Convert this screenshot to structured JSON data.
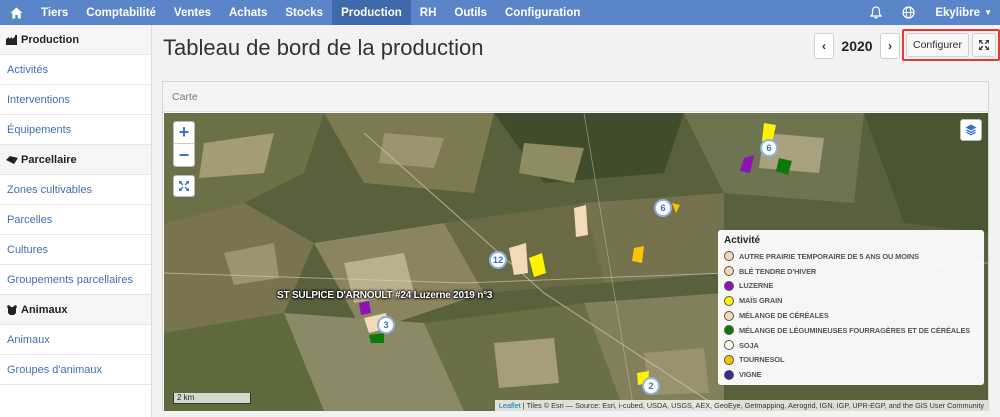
{
  "topnav": {
    "home_icon": "home-icon",
    "items": [
      {
        "label": "Tiers",
        "active": false
      },
      {
        "label": "Comptabilité",
        "active": false
      },
      {
        "label": "Ventes",
        "active": false
      },
      {
        "label": "Achats",
        "active": false
      },
      {
        "label": "Stocks",
        "active": false
      },
      {
        "label": "Production",
        "active": true
      },
      {
        "label": "RH",
        "active": false
      },
      {
        "label": "Outils",
        "active": false
      },
      {
        "label": "Configuration",
        "active": false
      }
    ],
    "notifications_icon": "bell-icon",
    "language_icon": "globe-icon",
    "user_label": "Ekylibre"
  },
  "sidebar": {
    "sections": [
      {
        "title": "Production",
        "icon": "production-icon",
        "links": [
          "Activités",
          "Interventions",
          "Équipements"
        ]
      },
      {
        "title": "Parcellaire",
        "icon": "land-parcel-icon",
        "links": [
          "Zones cultivables",
          "Parcelles",
          "Cultures",
          "Groupements parcellaires"
        ]
      },
      {
        "title": "Animaux",
        "icon": "animal-icon",
        "links": [
          "Animaux",
          "Groupes d'animaux"
        ]
      }
    ]
  },
  "page": {
    "title": "Tableau de bord de la production",
    "year": "2020",
    "configure_label": "Configurer",
    "accent_color": "#5a86c9",
    "highlight_color": "#e53935"
  },
  "map_panel": {
    "title": "Carte",
    "clusters": [
      "6",
      "6",
      "12",
      "3",
      "2"
    ],
    "tooltip": "ST SULPICE D'ARNOULT #24 Luzerne 2019 n°3",
    "legend": {
      "title": "Activité",
      "items": [
        {
          "label": "AUTRE PRAIRIE TEMPORAIRE DE 5 ANS OU MOINS",
          "color": "#f2d9b8"
        },
        {
          "label": "BLÉ TENDRE D'HIVER",
          "color": "#f2d9b8"
        },
        {
          "label": "LUZERNE",
          "color": "#8e13b5"
        },
        {
          "label": "MAÏS GRAIN",
          "color": "#fff200"
        },
        {
          "label": "MÉLANGE DE CÉRÉALES",
          "color": "#f2d9b8"
        },
        {
          "label": "MÉLANGE DE LÉGUMINEUSES FOURRAGÈRES ET DE CÉRÉALES",
          "color": "#0b7a0b"
        },
        {
          "label": "SOJA",
          "color": "#fff8e6"
        },
        {
          "label": "TOURNESOL",
          "color": "#f7c600"
        },
        {
          "label": "VIGNE",
          "color": "#3a2a8a"
        }
      ]
    },
    "scale_label": "2 km",
    "attribution_link": "Leaflet",
    "attribution_text": " | Tiles © Esri — Source: Esri, i-cubed, USDA, USGS, AEX, GeoEye, Getmapping, Aerogrid, IGN, IGP, UPR-EGP, and the GIS User Community"
  }
}
